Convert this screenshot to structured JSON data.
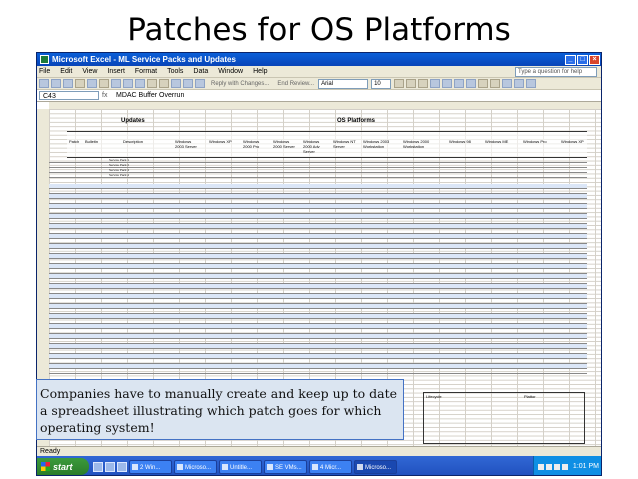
{
  "slide": {
    "title": "Patches for OS Platforms",
    "callout": "Companies have to manually create and keep up to date a spreadsheet illustrating which patch goes for which operating system!"
  },
  "window": {
    "title": "Microsoft Excel - ML Service Packs and Updates"
  },
  "menu": {
    "items": [
      "File",
      "Edit",
      "View",
      "Insert",
      "Format",
      "Tools",
      "Data",
      "Window",
      "Help"
    ],
    "question_placeholder": "Type a question for help"
  },
  "toolbar": {
    "font": "Arial",
    "size": "10",
    "reply": "Reply with Changes...",
    "end_review": "End Review..."
  },
  "formula": {
    "cell": "C43",
    "fx": "fx",
    "content": "MDAC Buffer Overrun"
  },
  "sheet": {
    "left_title": "Updates",
    "right_title": "OS Platforms",
    "headers": [
      "Patch",
      "Bulletin",
      "Description",
      "Windows 2003 Server",
      "Windows XP",
      "Windows 2000 Pro",
      "Windows 2000 Server",
      "Windows 2000 Adv Server",
      "Windows NT Server",
      "Windows 2003 Workstation",
      "Windows 2000 Workstation",
      "Windows 98",
      "Windows ME",
      "Windows Pro",
      "Windows XP"
    ],
    "service_pack_rows": [
      "Service Pack 1",
      "Service Pack 2",
      "Service Pack 3",
      "Service Pack 4"
    ],
    "lower_headers": [
      "Lifecycle",
      "Plattor"
    ],
    "status": "Ready"
  },
  "taskbar": {
    "start": "start",
    "tasks": [
      "2 Win...",
      "Microso...",
      "Untitle...",
      "SE VMs...",
      "4 Micr...",
      "Microso..."
    ],
    "clock": "1:01 PM"
  },
  "colors": {
    "title_bar": "#0a5fd8",
    "taskbar": "#3168d5",
    "start_button": "#2a7d2a",
    "callout_fill": "#dbe5f1",
    "callout_border": "#4472c4"
  }
}
